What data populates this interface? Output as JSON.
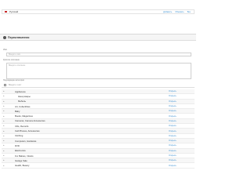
{
  "panel": {
    "title": "Переключатели"
  },
  "language": {
    "name": "Русский",
    "links": [
      "Добавить",
      "Обновить",
      "Все"
    ]
  },
  "fields": {
    "name_label": "Имя",
    "name_placeholder": "Введите имя",
    "description_label": "Краткое описание",
    "description_placeholder": "Введите описание",
    "category_label": "Подходящие категории"
  },
  "search": {
    "placeholder": "Введите текст"
  },
  "rows": [
    {
      "name": "Appliances",
      "action": "Открыть",
      "sub": false
    },
    {
      "name": "Канцтовары",
      "action": "Открыть",
      "sub": true
    },
    {
      "name": "Мебель",
      "action": "Открыть",
      "sub": true
    },
    {
      "name": "Art, Collectibles",
      "action": "Открыть",
      "sub": false
    },
    {
      "name": "Baby",
      "action": "Открыть",
      "sub": false
    },
    {
      "name": "Books, Magazines",
      "action": "Открыть",
      "sub": false
    },
    {
      "name": "Cameras, Camera Accessories",
      "action": "Открыть",
      "sub": false
    },
    {
      "name": "CDs, Records",
      "action": "Открыть",
      "sub": false
    },
    {
      "name": "Cell Phones, Accessories",
      "action": "Открыть",
      "sub": false
    },
    {
      "name": "Clothing",
      "action": "Открыть",
      "sub": false
    },
    {
      "name": "Computers, Hardware",
      "action": "Открыть",
      "sub": false
    },
    {
      "name": "DVD",
      "action": "Открыть",
      "sub": false
    },
    {
      "name": "Electronics",
      "action": "Открыть",
      "sub": false
    },
    {
      "name": "For Babies, Infants",
      "action": "Открыть",
      "sub": false
    },
    {
      "name": "Garage Sale",
      "action": "Открыть",
      "sub": false
    },
    {
      "name": "Health, Beauty",
      "action": "Открыть",
      "sub": false
    }
  ]
}
